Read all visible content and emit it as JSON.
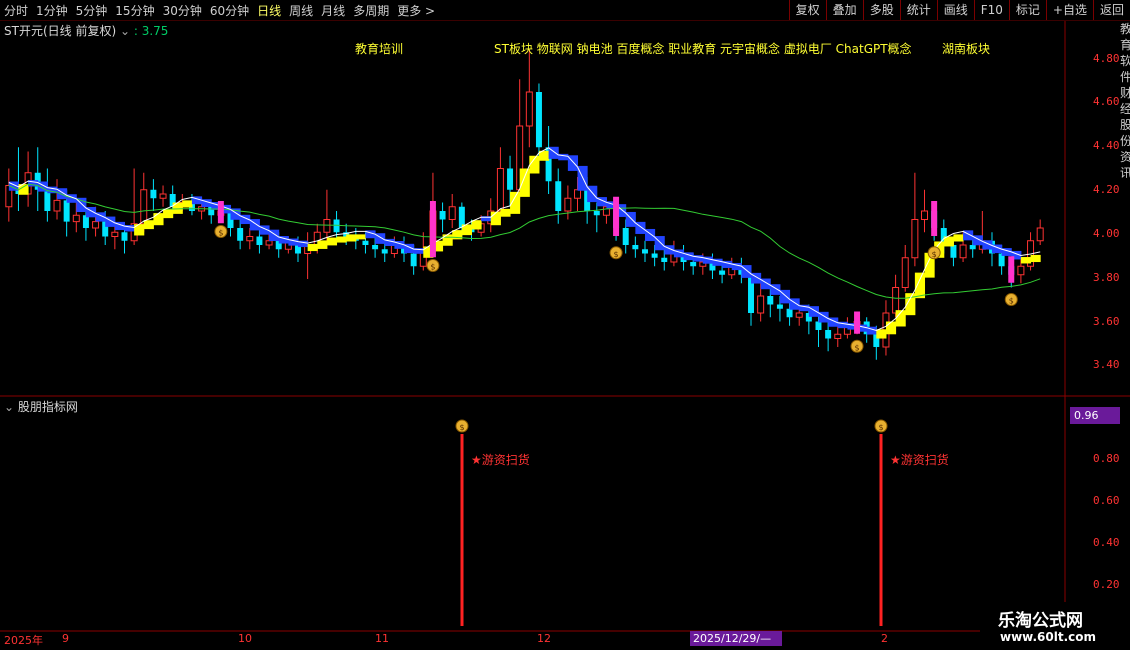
{
  "toolbar": {
    "periods": [
      "分时",
      "1分钟",
      "5分钟",
      "15分钟",
      "30分钟",
      "60分钟",
      "日线",
      "周线",
      "月线",
      "多周期",
      "更多 >"
    ],
    "active_period": "日线",
    "actions": [
      "复权",
      "叠加",
      "多股",
      "统计",
      "画线",
      "F10",
      "标记",
      "+自选",
      "返回"
    ]
  },
  "stock": {
    "title": "ST开元(日线 前复权)",
    "indicator_value": ": 3.75"
  },
  "concepts": {
    "c1": "教育培训",
    "c2": "ST板块 物联网 钠电池 百度概念 职业教育 元宇宙概念 虚拟电厂 ChatGPT概念",
    "c3": "湖南板块"
  },
  "price_axis": [
    "4.80",
    "4.60",
    "4.40",
    "4.20",
    "4.00",
    "3.80",
    "3.60",
    "3.40"
  ],
  "sub_indicator": {
    "title": "股朋指标网",
    "value_badge": "0.96",
    "axis": [
      "0.80",
      "0.60",
      "0.40",
      "0.20"
    ],
    "signals": [
      "★游资扫货",
      "★游资扫货"
    ]
  },
  "date_axis": {
    "labels": [
      "2025年",
      "9",
      "10",
      "11",
      "12",
      "2"
    ],
    "highlight": "2025/12/29/—"
  },
  "watermark": {
    "line1": "乐淘公式网",
    "line2": "www.60lt.com"
  },
  "right_strip": "教育软件财经股份资讯",
  "colors": {
    "up": "#ff3333",
    "down": "#00e5ff",
    "yellow_band": "#ffff00",
    "blue_band": "#2244ff",
    "ma": "#33cc33",
    "highlight": "#ff33cc"
  },
  "chart_data": {
    "type": "candlestick",
    "ylim": [
      3.3,
      4.9
    ],
    "candles": [
      [
        4.12,
        4.22,
        4.3,
        4.05
      ],
      [
        4.22,
        4.18,
        4.4,
        4.1
      ],
      [
        4.18,
        4.28,
        4.38,
        4.12
      ],
      [
        4.28,
        4.2,
        4.4,
        4.1
      ],
      [
        4.2,
        4.1,
        4.3,
        4.05
      ],
      [
        4.1,
        4.15,
        4.25,
        4.06
      ],
      [
        4.15,
        4.05,
        4.2,
        3.98
      ],
      [
        4.05,
        4.08,
        4.15,
        4.0
      ],
      [
        4.08,
        4.02,
        4.12,
        3.96
      ],
      [
        4.02,
        4.05,
        4.12,
        3.98
      ],
      [
        4.05,
        3.98,
        4.1,
        3.94
      ],
      [
        3.98,
        4.0,
        4.05,
        3.92
      ],
      [
        4.0,
        3.96,
        4.04,
        3.9
      ],
      [
        3.96,
        4.04,
        4.3,
        3.94
      ],
      [
        4.04,
        4.2,
        4.28,
        4.0
      ],
      [
        4.2,
        4.16,
        4.25,
        4.1
      ],
      [
        4.16,
        4.18,
        4.22,
        4.12
      ],
      [
        4.18,
        4.12,
        4.22,
        4.08
      ],
      [
        4.12,
        4.14,
        4.18,
        4.1
      ],
      [
        4.14,
        4.1,
        4.18,
        4.08
      ],
      [
        4.1,
        4.12,
        4.16,
        4.06
      ],
      [
        4.12,
        4.08,
        4.14,
        4.04
      ],
      [
        4.08,
        4.1,
        4.14,
        4.06
      ],
      [
        4.1,
        4.02,
        4.12,
        3.98
      ],
      [
        4.02,
        3.96,
        4.06,
        3.92
      ],
      [
        3.96,
        3.98,
        4.02,
        3.92
      ],
      [
        3.98,
        3.94,
        4.02,
        3.9
      ],
      [
        3.94,
        3.96,
        4.0,
        3.92
      ],
      [
        3.96,
        3.92,
        4.0,
        3.88
      ],
      [
        3.92,
        3.95,
        3.98,
        3.9
      ],
      [
        3.95,
        3.9,
        3.98,
        3.86
      ],
      [
        3.9,
        3.94,
        4.0,
        3.78
      ],
      [
        3.94,
        4.0,
        4.04,
        3.9
      ],
      [
        4.0,
        4.06,
        4.2,
        3.96
      ],
      [
        4.06,
        4.0,
        4.1,
        3.96
      ],
      [
        4.0,
        3.98,
        4.04,
        3.94
      ],
      [
        3.98,
        3.96,
        4.02,
        3.92
      ],
      [
        3.96,
        3.94,
        4.0,
        3.9
      ],
      [
        3.94,
        3.92,
        3.98,
        3.88
      ],
      [
        3.92,
        3.9,
        3.96,
        3.86
      ],
      [
        3.9,
        3.94,
        3.98,
        3.88
      ],
      [
        3.94,
        3.9,
        3.98,
        3.86
      ],
      [
        3.9,
        3.84,
        3.94,
        3.8
      ],
      [
        3.84,
        3.92,
        4.0,
        3.82
      ],
      [
        3.92,
        4.1,
        4.28,
        3.9
      ],
      [
        4.1,
        4.06,
        4.14,
        4.0
      ],
      [
        4.06,
        4.12,
        4.18,
        4.02
      ],
      [
        4.12,
        4.02,
        4.14,
        3.98
      ],
      [
        4.02,
        4.0,
        4.06,
        3.96
      ],
      [
        4.0,
        4.04,
        4.08,
        3.98
      ],
      [
        4.04,
        4.1,
        4.16,
        4.0
      ],
      [
        4.1,
        4.3,
        4.4,
        4.06
      ],
      [
        4.3,
        4.2,
        4.36,
        4.12
      ],
      [
        4.2,
        4.5,
        4.72,
        4.16
      ],
      [
        4.5,
        4.66,
        4.86,
        4.4
      ],
      [
        4.66,
        4.4,
        4.7,
        4.3
      ],
      [
        4.4,
        4.24,
        4.5,
        4.18
      ],
      [
        4.24,
        4.1,
        4.3,
        4.04
      ],
      [
        4.1,
        4.16,
        4.22,
        4.06
      ],
      [
        4.16,
        4.2,
        4.26,
        4.1
      ],
      [
        4.2,
        4.1,
        4.26,
        4.04
      ],
      [
        4.1,
        4.08,
        4.14,
        4.0
      ],
      [
        4.08,
        4.12,
        4.16,
        4.04
      ],
      [
        4.12,
        4.02,
        4.16,
        3.96
      ],
      [
        4.02,
        3.94,
        4.06,
        3.9
      ],
      [
        3.94,
        3.92,
        3.98,
        3.88
      ],
      [
        3.92,
        3.9,
        3.96,
        3.86
      ],
      [
        3.9,
        3.88,
        3.94,
        3.84
      ],
      [
        3.88,
        3.86,
        3.92,
        3.82
      ],
      [
        3.86,
        3.9,
        3.96,
        3.84
      ],
      [
        3.9,
        3.86,
        3.94,
        3.82
      ],
      [
        3.86,
        3.84,
        3.9,
        3.8
      ],
      [
        3.84,
        3.86,
        3.9,
        3.8
      ],
      [
        3.86,
        3.82,
        3.9,
        3.78
      ],
      [
        3.82,
        3.8,
        3.86,
        3.76
      ],
      [
        3.8,
        3.84,
        3.88,
        3.78
      ],
      [
        3.84,
        3.8,
        3.88,
        3.76
      ],
      [
        3.8,
        3.62,
        3.84,
        3.56
      ],
      [
        3.62,
        3.7,
        3.76,
        3.58
      ],
      [
        3.7,
        3.66,
        3.74,
        3.6
      ],
      [
        3.66,
        3.64,
        3.7,
        3.58
      ],
      [
        3.64,
        3.6,
        3.68,
        3.56
      ],
      [
        3.6,
        3.62,
        3.66,
        3.56
      ],
      [
        3.62,
        3.58,
        3.66,
        3.52
      ],
      [
        3.58,
        3.54,
        3.62,
        3.46
      ],
      [
        3.54,
        3.5,
        3.58,
        3.44
      ],
      [
        3.5,
        3.52,
        3.56,
        3.46
      ],
      [
        3.52,
        3.56,
        3.6,
        3.5
      ],
      [
        3.56,
        3.58,
        3.62,
        3.52
      ],
      [
        3.58,
        3.52,
        3.6,
        3.48
      ],
      [
        3.52,
        3.46,
        3.56,
        3.4
      ],
      [
        3.46,
        3.62,
        3.68,
        3.42
      ],
      [
        3.62,
        3.74,
        3.8,
        3.6
      ],
      [
        3.74,
        3.88,
        3.94,
        3.72
      ],
      [
        3.88,
        4.06,
        4.28,
        3.84
      ],
      [
        4.06,
        4.1,
        4.2,
        4.0
      ],
      [
        4.1,
        4.02,
        4.14,
        3.96
      ],
      [
        4.02,
        3.94,
        4.06,
        3.9
      ],
      [
        3.94,
        3.88,
        3.98,
        3.84
      ],
      [
        3.88,
        3.94,
        4.0,
        3.86
      ],
      [
        3.94,
        3.92,
        3.98,
        3.88
      ],
      [
        3.92,
        3.96,
        4.1,
        3.9
      ],
      [
        3.96,
        3.9,
        4.0,
        3.84
      ],
      [
        3.9,
        3.84,
        3.94,
        3.8
      ],
      [
        3.84,
        3.8,
        3.88,
        3.74
      ],
      [
        3.8,
        3.84,
        3.88,
        3.76
      ],
      [
        3.84,
        3.96,
        4.0,
        3.82
      ],
      [
        3.96,
        4.02,
        4.06,
        3.94
      ]
    ]
  }
}
